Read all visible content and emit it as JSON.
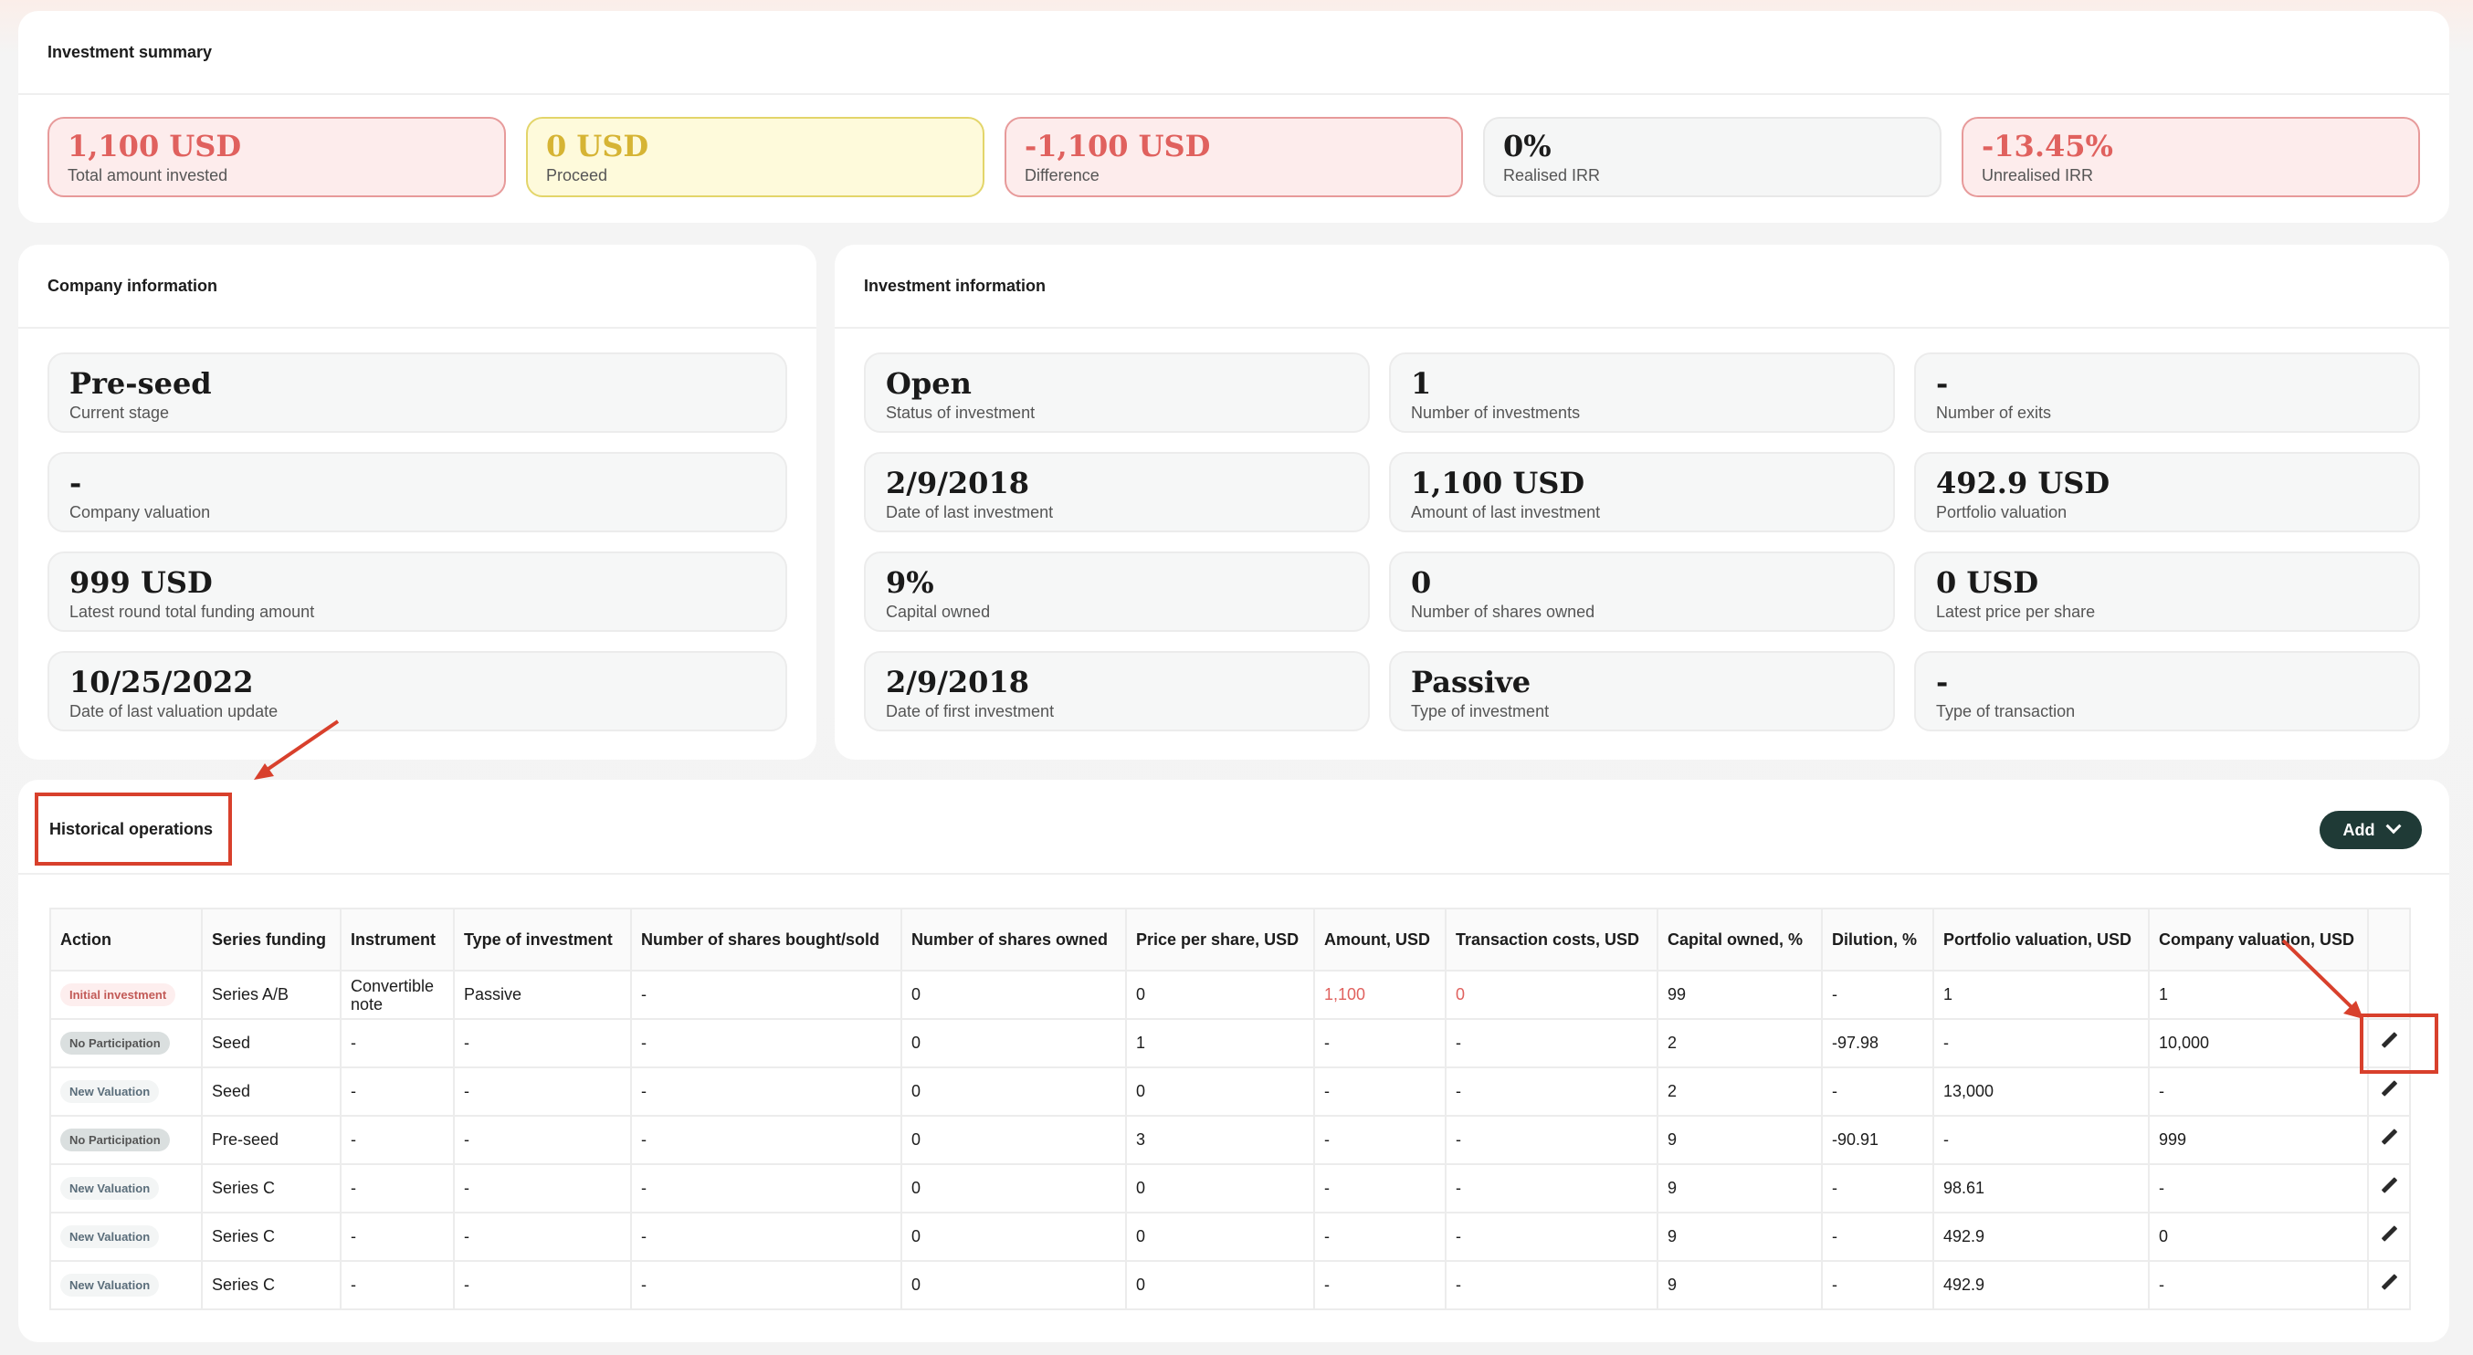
{
  "summary": {
    "title": "Investment summary",
    "tiles": [
      {
        "value": "1,100 USD",
        "label": "Total amount invested"
      },
      {
        "value": "0 USD",
        "label": "Proceed"
      },
      {
        "value": "-1,100 USD",
        "label": "Difference"
      },
      {
        "value": "0%",
        "label": "Realised IRR"
      },
      {
        "value": "-13.45%",
        "label": "Unrealised IRR"
      }
    ]
  },
  "company": {
    "title": "Company information",
    "tiles": [
      {
        "value": "Pre-seed",
        "label": "Current stage"
      },
      {
        "value": "-",
        "label": "Company valuation"
      },
      {
        "value": "999 USD",
        "label": "Latest round total funding amount"
      },
      {
        "value": "10/25/2022",
        "label": "Date of last valuation update"
      }
    ]
  },
  "investment": {
    "title": "Investment information",
    "tiles": [
      {
        "value": "Open",
        "label": "Status of investment"
      },
      {
        "value": "1",
        "label": "Number of investments"
      },
      {
        "value": "-",
        "label": "Number of exits"
      },
      {
        "value": "2/9/2018",
        "label": "Date of last investment"
      },
      {
        "value": "1,100 USD",
        "label": "Amount of last investment"
      },
      {
        "value": "492.9 USD",
        "label": "Portfolio valuation"
      },
      {
        "value": "9%",
        "label": "Capital owned"
      },
      {
        "value": "0",
        "label": "Number of shares owned"
      },
      {
        "value": "0 USD",
        "label": "Latest price per share"
      },
      {
        "value": "2/9/2018",
        "label": "Date of first investment"
      },
      {
        "value": "Passive",
        "label": "Type of investment"
      },
      {
        "value": "-",
        "label": "Type of transaction"
      }
    ]
  },
  "history": {
    "title": "Historical operations",
    "add_label": "Add",
    "columns": [
      "Action",
      "Series funding",
      "Instrument",
      "Type of investment",
      "Number of shares bought/sold",
      "Number of shares owned",
      "Price per share, USD",
      "Amount, USD",
      "Transaction costs, USD",
      "Capital owned, %",
      "Dilution, %",
      "Portfolio valuation, USD",
      "Company valuation, USD"
    ],
    "rows": [
      {
        "action": "Initial investment",
        "cells": [
          "Series A/B",
          "Convertible note",
          "Passive",
          "-",
          "0",
          "0",
          "1,100",
          "0",
          "99",
          "-",
          "1",
          "1"
        ]
      },
      {
        "action": "No Participation",
        "cells": [
          "Seed",
          "-",
          "-",
          "-",
          "0",
          "1",
          "-",
          "-",
          "2",
          "-97.98",
          "-",
          "10,000"
        ]
      },
      {
        "action": "New Valuation",
        "cells": [
          "Seed",
          "-",
          "-",
          "-",
          "0",
          "0",
          "-",
          "-",
          "2",
          "-",
          "13,000",
          "-"
        ]
      },
      {
        "action": "No Participation",
        "cells": [
          "Pre-seed",
          "-",
          "-",
          "-",
          "0",
          "3",
          "-",
          "-",
          "9",
          "-90.91",
          "-",
          "999"
        ]
      },
      {
        "action": "New Valuation",
        "cells": [
          "Series C",
          "-",
          "-",
          "-",
          "0",
          "0",
          "-",
          "-",
          "9",
          "-",
          "98.61",
          "-"
        ]
      },
      {
        "action": "New Valuation",
        "cells": [
          "Series C",
          "-",
          "-",
          "-",
          "0",
          "0",
          "-",
          "-",
          "9",
          "-",
          "492.9",
          "0"
        ]
      },
      {
        "action": "New Valuation",
        "cells": [
          "Series C",
          "-",
          "-",
          "-",
          "0",
          "0",
          "-",
          "-",
          "9",
          "-",
          "492.9",
          "-"
        ]
      }
    ]
  },
  "colors": {
    "accent": "#1f3a36",
    "negative": "#e0615e",
    "annotation": "#d8402c"
  }
}
